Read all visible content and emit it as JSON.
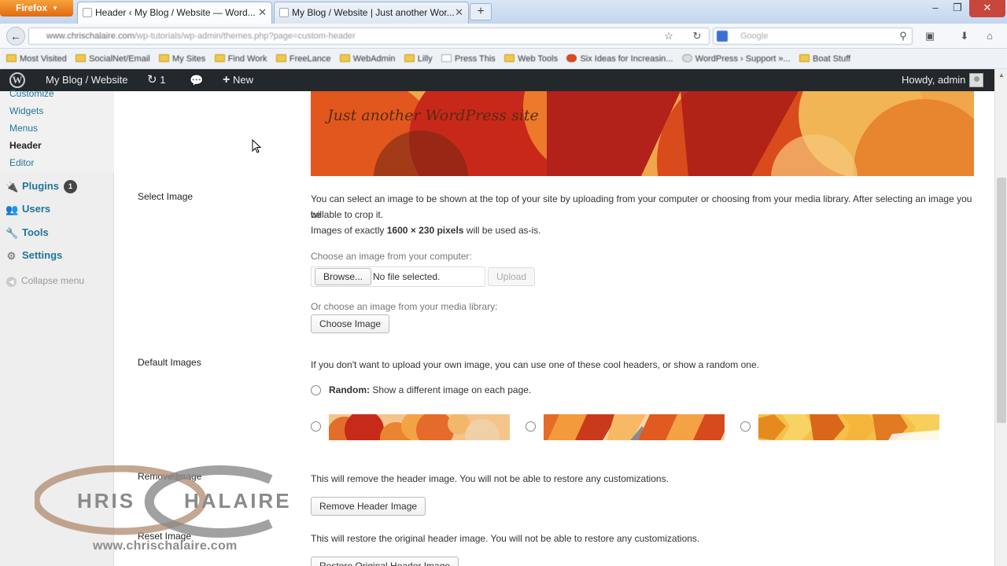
{
  "browser": {
    "menu_button": "Firefox",
    "tabs": [
      {
        "title": "Header ‹ My Blog / Website — Word...",
        "active": true
      },
      {
        "title": "My Blog / Website | Just another Wor...",
        "active": false
      }
    ],
    "url_host": "www.chrischalaire.com",
    "url_path": "/wp-tutorials/wp-admin/themes.php?page=custom-header",
    "search_placeholder": "Google",
    "bookmarks": [
      "Most Visited",
      "SocialNet/Email",
      "My Sites",
      "Find Work",
      "FreeLance",
      "WebAdmin",
      "Lilly",
      "Press This",
      "Web Tools",
      "Six Ideas for Increasin...",
      "WordPress › Support »...",
      "Boat Stuff"
    ]
  },
  "admin_bar": {
    "site_name": "My Blog / Website",
    "updates_count": "1",
    "new_label": "New",
    "greeting": "Howdy, admin"
  },
  "sidebar": {
    "appearance_submenu": [
      "Customize",
      "Widgets",
      "Menus",
      "Header",
      "Editor"
    ],
    "current_submenu": "Header",
    "menu": {
      "plugins": "Plugins",
      "plugins_badge": "1",
      "users": "Users",
      "tools": "Tools",
      "settings": "Settings"
    },
    "collapse_label": "Collapse menu"
  },
  "header_preview": {
    "tagline": "Just another WordPress site"
  },
  "select_image": {
    "label": "Select Image",
    "description": "You can select an image to be shown at the top of your site by uploading from your computer or choosing from your media library. After selecting an image you will",
    "description_cont": "be able to crop it.",
    "size_prefix": "Images of exactly ",
    "size_value": "1600 × 230 pixels",
    "size_suffix": " will be used as-is.",
    "computer_label": "Choose an image from your computer:",
    "browse_button": "Browse...",
    "file_status": "No file selected.",
    "upload_button": "Upload",
    "library_label": "Or choose an image from your media library:",
    "choose_button": "Choose Image"
  },
  "default_images": {
    "label": "Default Images",
    "description": "If you don't want to upload your own image, you can use one of these cool headers, or show a random one.",
    "random_label": "Random:",
    "random_desc": " Show a different image on each page."
  },
  "remove_image": {
    "label": "Remove Image",
    "description": "This will remove the header image. You will not be able to restore any customizations.",
    "button": "Remove Header Image"
  },
  "reset_image": {
    "label": "Reset Image",
    "description": "This will restore the original header image. You will not be able to restore any customizations.",
    "button": "Restore Original Header Image"
  },
  "watermark": {
    "name_left": "HRIS",
    "name_right": "HALAIRE",
    "url": "www.chrischalaire.com"
  },
  "colors": {
    "admin_bar_bg": "#23282d",
    "link_blue": "#21759b",
    "banner_orange": "#ef9a3c",
    "firefox_orange": "#e26a10"
  }
}
